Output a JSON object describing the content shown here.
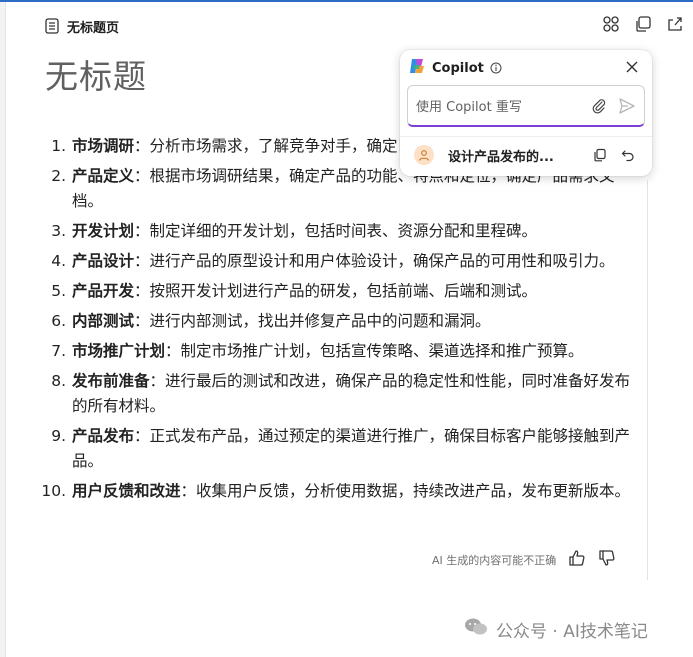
{
  "header": {
    "title": "无标题页"
  },
  "page": {
    "title": "无标题"
  },
  "steps": [
    {
      "num": "1.",
      "term": "市场调研",
      "desc": "：分析市场需求，了解竞争对手，确定目标客户群体。"
    },
    {
      "num": "2.",
      "term": "产品定义",
      "desc": "：根据市场调研结果，确定产品的功能、特点和定位，确定产品需求文档。"
    },
    {
      "num": "3.",
      "term": "开发计划",
      "desc": "：制定详细的开发计划，包括时间表、资源分配和里程碑。"
    },
    {
      "num": "4.",
      "term": "产品设计",
      "desc": "：进行产品的原型设计和用户体验设计，确保产品的可用性和吸引力。"
    },
    {
      "num": "5.",
      "term": "产品开发",
      "desc": "：按照开发计划进行产品的研发，包括前端、后端和测试。"
    },
    {
      "num": "6.",
      "term": "内部测试",
      "desc": "：进行内部测试，找出并修复产品中的问题和漏洞。"
    },
    {
      "num": "7.",
      "term": "市场推广计划",
      "desc": "：制定市场推广计划，包括宣传策略、渠道选择和推广预算。"
    },
    {
      "num": "8.",
      "term": "发布前准备",
      "desc": "：进行最后的测试和改进，确保产品的稳定性和性能，同时准备好发布的所有材料。"
    },
    {
      "num": "9.",
      "term": "产品发布",
      "desc": "：正式发布产品，通过预定的渠道进行推广，确保目标客户能够接触到产品。"
    },
    {
      "num": "10.",
      "term": "用户反馈和改进",
      "desc": "：收集用户反馈，分析使用数据，持续改进产品，发布更新版本。"
    }
  ],
  "footer": {
    "disclaimer": "AI 生成的内容可能不正确"
  },
  "copilot": {
    "title": "Copilot",
    "input_placeholder": "使用 Copilot 重写",
    "suggestion": "设计产品发布的..."
  },
  "watermark": {
    "text": "公众号 · AI技术笔记"
  },
  "colors": {
    "accent": "#7b3fd4",
    "topline": "#2b6cc4"
  }
}
